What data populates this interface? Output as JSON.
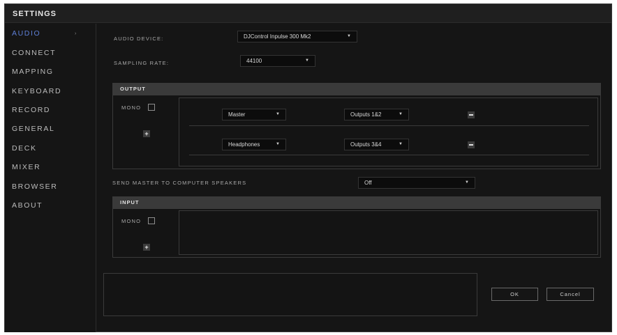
{
  "window": {
    "title": "SETTINGS"
  },
  "sidebar": {
    "items": [
      {
        "label": "AUDIO",
        "active": true
      },
      {
        "label": "CONNECT"
      },
      {
        "label": "MAPPING"
      },
      {
        "label": "KEYBOARD"
      },
      {
        "label": "RECORD"
      },
      {
        "label": "GENERAL"
      },
      {
        "label": "DECK"
      },
      {
        "label": "MIXER"
      },
      {
        "label": "BROWSER"
      },
      {
        "label": "ABOUT"
      }
    ],
    "active_arrow": "›"
  },
  "audio_device": {
    "label": "AUDIO DEVICE:",
    "value": "DJControl Inpulse 300 Mk2"
  },
  "sampling_rate": {
    "label": "SAMPLING RATE:",
    "value": "44100"
  },
  "output": {
    "header": "OUTPUT",
    "mono_label": "MONO",
    "mono_checked": false,
    "add_label": "+",
    "rows": [
      {
        "channel": "Master",
        "outputs": "Outputs 1&2"
      },
      {
        "channel": "Headphones",
        "outputs": "Outputs 3&4"
      }
    ]
  },
  "send_master": {
    "label": "SEND MASTER TO COMPUTER SPEAKERS",
    "value": "Off"
  },
  "input": {
    "header": "INPUT",
    "mono_label": "MONO",
    "mono_checked": false,
    "add_label": "+"
  },
  "buttons": {
    "ok": "OK",
    "cancel": "Cancel"
  },
  "colors": {
    "accent": "#5e7fd6",
    "background": "#151515",
    "section_header": "#3a3a3a"
  }
}
